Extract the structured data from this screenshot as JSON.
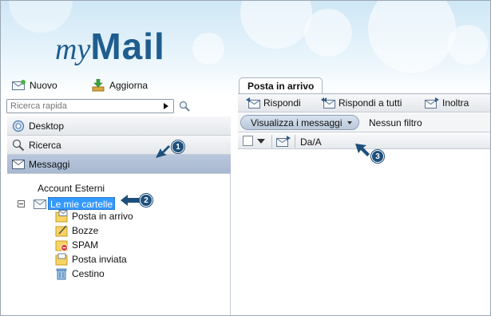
{
  "app": {
    "logo_my": "my",
    "logo_mail": "Mail"
  },
  "toolbar_top": {
    "new_label": "Nuovo",
    "refresh_label": "Aggiorna"
  },
  "search": {
    "placeholder": "Ricerca rapida"
  },
  "nav": {
    "desktop": "Desktop",
    "search": "Ricerca",
    "messages": "Messaggi"
  },
  "tree": {
    "external_accounts": "Account Esterni",
    "my_folders": "Le mie cartelle",
    "folders": [
      "Posta in arrivo",
      "Bozze",
      "SPAM",
      "Posta inviata",
      "Cestino"
    ]
  },
  "tab": {
    "inbox": "Posta in arrivo"
  },
  "message_toolbar": {
    "reply": "Rispondi",
    "reply_all": "Rispondi a tutti",
    "forward": "Inoltra"
  },
  "filter": {
    "view_messages": "Visualizza i messaggi",
    "no_filter": "Nessun filtro"
  },
  "columns": {
    "from_to": "Da/A"
  },
  "callouts": [
    "1",
    "2",
    "3"
  ],
  "colors": {
    "accent": "#1f5d8e",
    "selection": "#3399ff",
    "callout": "#1d4f7a",
    "active_nav": "#b0c0d6"
  }
}
